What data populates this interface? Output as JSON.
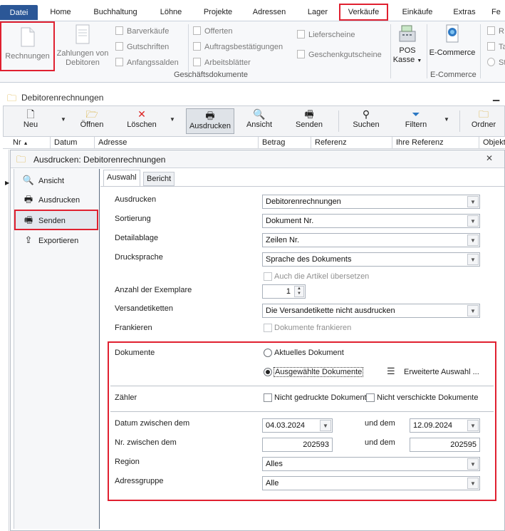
{
  "menubar": {
    "tabs": [
      "Datei",
      "Home",
      "Buchhaltung",
      "Löhne",
      "Projekte",
      "Adressen",
      "Lager",
      "Verkäufe",
      "Einkäufe",
      "Extras",
      "Fe"
    ]
  },
  "ribbon": {
    "rechnungen": "Rechnungen",
    "zahlungen": "Zahlungen von Debitoren",
    "col1": [
      "Barverkäufe",
      "Gutschriften",
      "Anfangssalden"
    ],
    "col2": [
      "Offerten",
      "Auftragsbestätigungen",
      "Arbeitsblätter"
    ],
    "col3": [
      "Lieferscheine",
      "Geschenkgutscheine"
    ],
    "group_label": "Geschäftsdokumente",
    "pos": "POS",
    "kasse": "Kasse",
    "ecommerce": "E-Commerce",
    "ecommerce_group": "E-Commerce",
    "right_col": [
      "R",
      "Ta",
      "St"
    ]
  },
  "module": {
    "title": "Debitorenrechnungen",
    "toolbar": [
      "Neu",
      "Öffnen",
      "Löschen",
      "Ausdrucken",
      "Ansicht",
      "Senden",
      "Suchen",
      "Filtern",
      "Ordner"
    ],
    "columns": [
      "Nr",
      "Datum",
      "Adresse",
      "Betrag",
      "Referenz",
      "Ihre Referenz",
      "Objekt"
    ]
  },
  "dialog": {
    "title": "Ausdrucken: Debitorenrechnungen",
    "nav": [
      "Ansicht",
      "Ausdrucken",
      "Senden",
      "Exportieren"
    ],
    "tabs": [
      "Auswahl",
      "Bericht"
    ],
    "labels": {
      "ausdrucken": "Ausdrucken",
      "sortierung": "Sortierung",
      "detailablage": "Detailablage",
      "drucksprache": "Drucksprache",
      "exemplare": "Anzahl der Exemplare",
      "versandetiketten": "Versandetiketten",
      "frankieren": "Frankieren",
      "dokumente": "Dokumente",
      "zaehler": "Zähler",
      "datum": "Datum zwischen dem",
      "nr": "Nr. zwischen dem",
      "und_dem": "und dem",
      "region": "Region",
      "adressgruppe": "Adressgruppe"
    },
    "values": {
      "ausdrucken": "Debitorenrechnungen",
      "sortierung": "Dokument Nr.",
      "detailablage": "Zeilen Nr.",
      "drucksprache": "Sprache des Dokuments",
      "artikel_uebersetzen": "Auch die Artikel übersetzen",
      "exemplare": "1",
      "versandetiketten": "Die Versandetikette nicht ausdrucken",
      "frankieren": "Dokumente frankieren",
      "radio_aktuell": "Aktuelles Dokument",
      "radio_ausgewaehlt": "Ausgewählte Dokumente",
      "erweiterte": "Erweiterte Auswahl ...",
      "nicht_gedruckt": "Nicht gedruckte Dokument",
      "nicht_verschickt": "Nicht verschickte Dokumente",
      "datum_von": "04.03.2024",
      "datum_bis": "12.09.2024",
      "nr_von": "202593",
      "nr_bis": "202595",
      "region": "Alles",
      "adressgruppe": "Alle"
    }
  }
}
